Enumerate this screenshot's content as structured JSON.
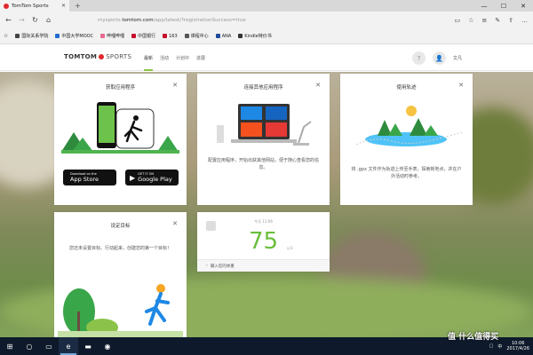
{
  "browser": {
    "tab_title": "TomTom Sports",
    "url_host": "mysports.tomtom.com",
    "url_prefix": "mysports.",
    "url_domain": "tomtom.com",
    "url_path": "/app/latest/?registrationSuccess=true",
    "bookmarks": [
      {
        "label": "国际关系学院",
        "color": "#444"
      },
      {
        "label": "中国大学MOOC",
        "color": "#1f6fd1"
      },
      {
        "label": "哔哩哔哩",
        "color": "#e86b91"
      },
      {
        "label": "中国银行",
        "color": "#c8102e"
      },
      {
        "label": "163",
        "color": "#c8102e"
      },
      {
        "label": "课程中心",
        "color": "#555"
      },
      {
        "label": "ANA",
        "color": "#1e4b9c"
      },
      {
        "label": "Kindle特价书",
        "color": "#333"
      }
    ]
  },
  "site": {
    "logo_main": "TOMTOM",
    "logo_sub": "SPORTS",
    "nav": [
      {
        "label": "最新",
        "active": true
      },
      {
        "label": "活动",
        "active": false
      },
      {
        "label": "计划中",
        "active": false
      },
      {
        "label": "进展",
        "active": false
      }
    ],
    "help": "?",
    "user_name": "文凡"
  },
  "cards": {
    "get_app": {
      "title": "获取应用程序",
      "app_store_top": "Download on the",
      "app_store_bottom": "App Store",
      "google_play_top": "GET IT ON",
      "google_play_bottom": "Google Play"
    },
    "connect": {
      "title": "连接其他应用程序",
      "desc": "配置应用程序，开始出获其他网站，便于随心查看您的信息。"
    },
    "routes": {
      "title": "使用轨迹",
      "desc": "将 .gpx 文件作为轨迹上传至手表，探索新地点，并在户外活动时参考。"
    },
    "goal": {
      "title": "设定目标",
      "desc": "您还未设置目标。行动起来，创建您的第一个目标！"
    },
    "weight": {
      "today": "今天 11:06",
      "value": "75",
      "unit": "公斤",
      "input_label": "输入您的体重"
    }
  },
  "taskbar": {
    "lang": "中",
    "time": "10:06",
    "date": "2017/4/26",
    "watermark": "值 什么值得买"
  },
  "colors": {
    "accent_green": "#6abf3c",
    "brand_red": "#e0282e",
    "taskbar": "#0e1a2b"
  }
}
